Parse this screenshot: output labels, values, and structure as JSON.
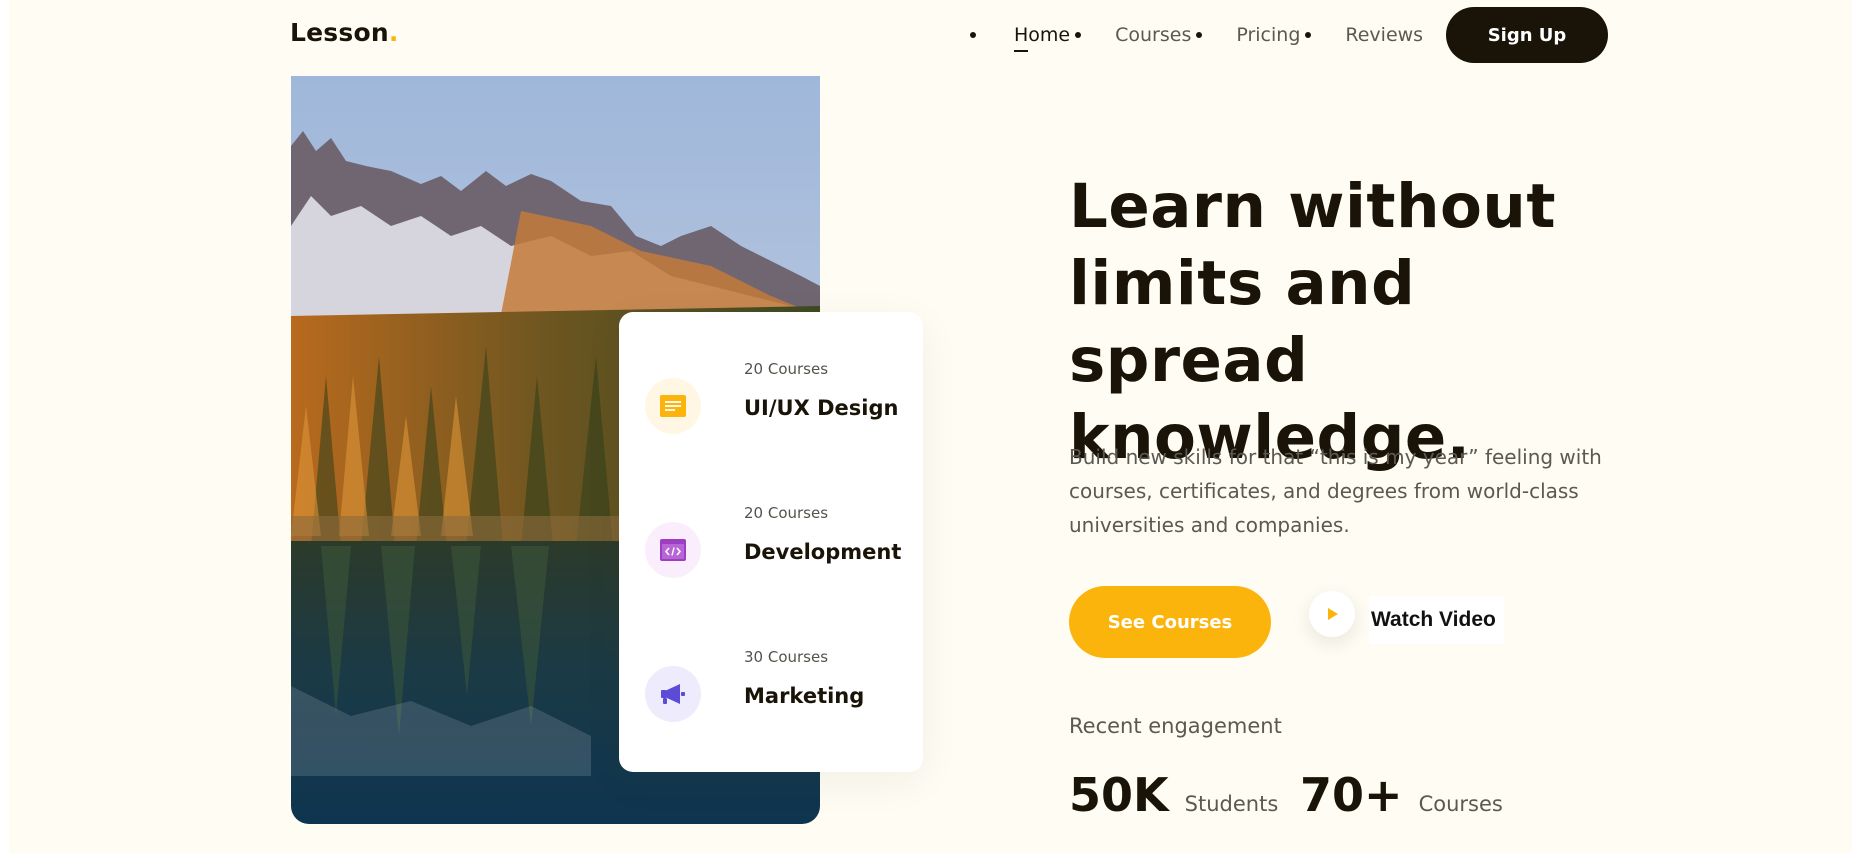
{
  "brand": {
    "name": "Lesson",
    "dot": ".",
    "accent_color": "#fbb40b",
    "dark_color": "#1a1408"
  },
  "nav": {
    "items": [
      {
        "label": "Home",
        "active": true
      },
      {
        "label": "Courses"
      },
      {
        "label": "Pricing"
      },
      {
        "label": "Reviews"
      }
    ],
    "signup_label": "Sign Up"
  },
  "categories": [
    {
      "count": "20 Courses",
      "title": "UI/UX Design",
      "icon": "document-icon",
      "color": "#fbb40b",
      "bg": "#fff7e3"
    },
    {
      "count": "20 Courses",
      "title": "Development",
      "icon": "code-window-icon",
      "color": "#9c3fc2",
      "bg": "#fbeefc"
    },
    {
      "count": "30 Courses",
      "title": "Marketing",
      "icon": "megaphone-icon",
      "color": "#5b4bd6",
      "bg": "#eeecfc"
    }
  ],
  "hero": {
    "headline_lines": [
      "Learn without",
      "limits and spread",
      "knowledge."
    ],
    "subtext": "Build new skills for that “this is my year” feeling with courses, certificates, and degrees from world-class universities and companies.",
    "primary_cta": "See Courses",
    "secondary_cta": "Watch Video",
    "play_icon": "play-icon"
  },
  "engagement": {
    "label": "Recent engagement",
    "stats": [
      {
        "value": "50K",
        "unit": "Students"
      },
      {
        "value": "70+",
        "unit": "Courses"
      }
    ]
  }
}
